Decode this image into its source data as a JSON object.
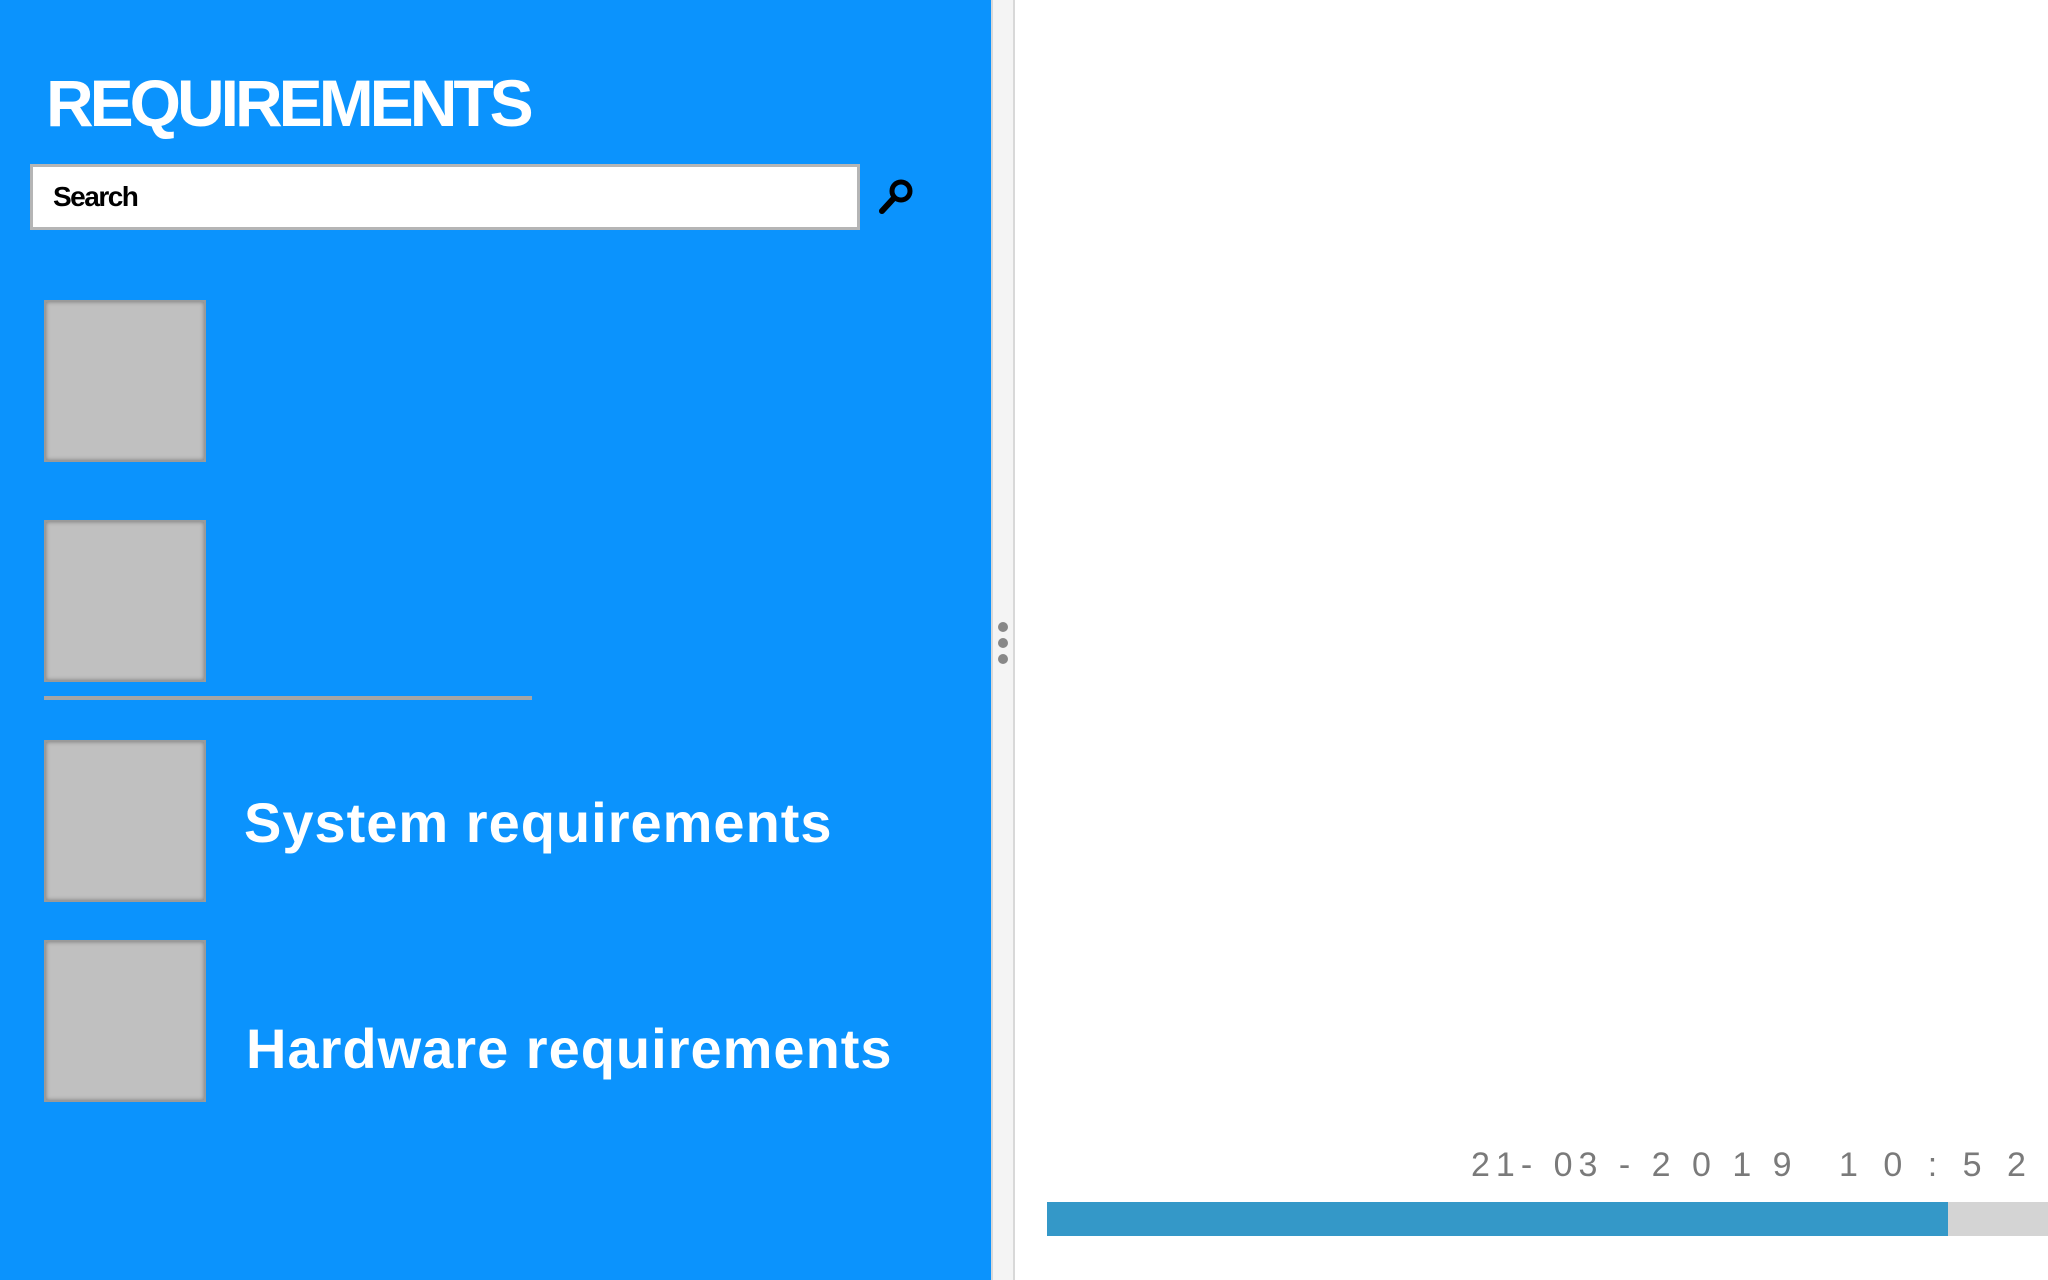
{
  "sidebar": {
    "title": "REQUIREMENTS",
    "search": {
      "placeholder": "Search",
      "value": ""
    },
    "items": [
      {
        "label": ""
      },
      {
        "label": ""
      },
      {
        "label": "System requirements"
      },
      {
        "label": "Hardware requirements"
      }
    ],
    "background_color": "#0b93fd"
  },
  "content": {
    "date": "21- 03 - 2 0 1 9",
    "time": "1 0 : 5 2",
    "progress": {
      "fraction": 0.9,
      "fill_color": "#3498c8",
      "track_color": "#d4d4d4"
    }
  },
  "icons": {
    "search": "search-icon",
    "splitter": "drag-handle-icon"
  }
}
